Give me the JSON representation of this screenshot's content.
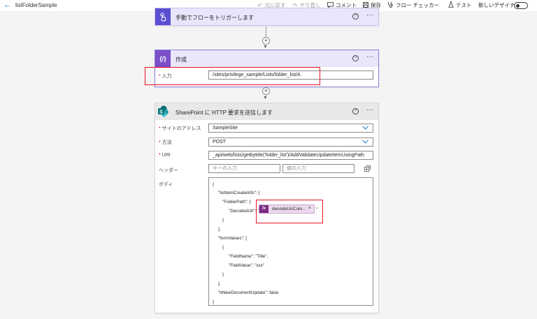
{
  "topbar": {
    "back_glyph": "←",
    "flow_name": "listFolderSample",
    "undo": "元に戻す",
    "redo": "やり直し",
    "comment": "コメント",
    "save": "保存",
    "flow_checker": "フロー チェッカー",
    "test": "テスト",
    "new_designer": "新しいデザイナー"
  },
  "card_trigger": {
    "title": "手動でフローをトリガーします",
    "help": "?",
    "more": "···"
  },
  "card_compose": {
    "badge": "{/}",
    "title": "作成",
    "help": "?",
    "more": "···",
    "input_label": "入力",
    "input_value": "/sites/privilege_sample/Lists/folder_list/A"
  },
  "card_http": {
    "title": "SharePoint に HTTP 要求を送信します",
    "help": "?",
    "more": "···",
    "site_label": "サイトのアドレス",
    "site_value": "SampleSite",
    "method_label": "方法",
    "method_value": "POST",
    "uri_label": "URI",
    "uri_value": "_api/web/lists/getbytitle('folder_list')/AddValidateUpdateItemUsingPath",
    "headers_label": "ヘッダー",
    "header_key_placeholder": "キーの入力",
    "header_value_placeholder": "値の入力",
    "body_label": "ボディ",
    "body_lines": [
      "{",
      "\"listItemCreateInfo\": {",
      "\"FolderPath\": {",
      "\"DecodedUrl\": \"",
      "}",
      "},",
      "\"formValues\": [",
      "{",
      "\"FieldName\": \"Title\",",
      "\"FieldValue\": \"xxx\"",
      "}",
      "],",
      "\"bNewDocumentUpdate\": false",
      "}"
    ],
    "token_label": "decodeUriCom...",
    "token_fx": "fx",
    "token_close": "×",
    "token_after": "\""
  },
  "connector": {
    "plus": "+"
  },
  "colors": {
    "accent": "#0f6cbd",
    "highlight": "#e81123",
    "trigger_badge": "#5a4fd1",
    "compose_badge": "#7a4fc8",
    "token_fx": "#7b2a83"
  }
}
